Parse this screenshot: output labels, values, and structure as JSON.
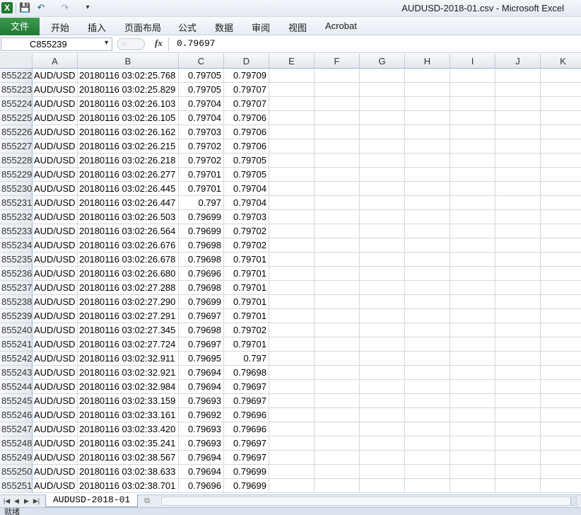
{
  "window": {
    "title": "AUDUSD-2018-01.csv  -  Microsoft Excel",
    "app_icon": "X"
  },
  "quick_access": {
    "save_icon": "💾",
    "undo_icon": "↶",
    "redo_icon": "↷",
    "customize_icon": "▾"
  },
  "ribbon": {
    "file_tab": "文件",
    "tabs": [
      "开始",
      "插入",
      "页面布局",
      "公式",
      "数据",
      "审阅",
      "视图",
      "Acrobat"
    ]
  },
  "formula_bar": {
    "name_box": "C855239",
    "fx": "fx",
    "value": "0.79697"
  },
  "columns": [
    "A",
    "B",
    "C",
    "D",
    "E",
    "F",
    "G",
    "H",
    "I",
    "J",
    "K"
  ],
  "rows": [
    {
      "n": "855222",
      "a": "AUD/USD",
      "b": "20180116 03:02:25.768",
      "c": "0.79705",
      "d": "0.79709"
    },
    {
      "n": "855223",
      "a": "AUD/USD",
      "b": "20180116 03:02:25.829",
      "c": "0.79705",
      "d": "0.79707"
    },
    {
      "n": "855224",
      "a": "AUD/USD",
      "b": "20180116 03:02:26.103",
      "c": "0.79704",
      "d": "0.79707"
    },
    {
      "n": "855225",
      "a": "AUD/USD",
      "b": "20180116 03:02:26.105",
      "c": "0.79704",
      "d": "0.79706"
    },
    {
      "n": "855226",
      "a": "AUD/USD",
      "b": "20180116 03:02:26.162",
      "c": "0.79703",
      "d": "0.79706"
    },
    {
      "n": "855227",
      "a": "AUD/USD",
      "b": "20180116 03:02:26.215",
      "c": "0.79702",
      "d": "0.79706"
    },
    {
      "n": "855228",
      "a": "AUD/USD",
      "b": "20180116 03:02:26.218",
      "c": "0.79702",
      "d": "0.79705"
    },
    {
      "n": "855229",
      "a": "AUD/USD",
      "b": "20180116 03:02:26.277",
      "c": "0.79701",
      "d": "0.79705"
    },
    {
      "n": "855230",
      "a": "AUD/USD",
      "b": "20180116 03:02:26.445",
      "c": "0.79701",
      "d": "0.79704"
    },
    {
      "n": "855231",
      "a": "AUD/USD",
      "b": "20180116 03:02:26.447",
      "c": "0.797",
      "d": "0.79704"
    },
    {
      "n": "855232",
      "a": "AUD/USD",
      "b": "20180116 03:02:26.503",
      "c": "0.79699",
      "d": "0.79703"
    },
    {
      "n": "855233",
      "a": "AUD/USD",
      "b": "20180116 03:02:26.564",
      "c": "0.79699",
      "d": "0.79702"
    },
    {
      "n": "855234",
      "a": "AUD/USD",
      "b": "20180116 03:02:26.676",
      "c": "0.79698",
      "d": "0.79702"
    },
    {
      "n": "855235",
      "a": "AUD/USD",
      "b": "20180116 03:02:26.678",
      "c": "0.79698",
      "d": "0.79701"
    },
    {
      "n": "855236",
      "a": "AUD/USD",
      "b": "20180116 03:02:26.680",
      "c": "0.79696",
      "d": "0.79701"
    },
    {
      "n": "855237",
      "a": "AUD/USD",
      "b": "20180116 03:02:27.288",
      "c": "0.79698",
      "d": "0.79701"
    },
    {
      "n": "855238",
      "a": "AUD/USD",
      "b": "20180116 03:02:27.290",
      "c": "0.79699",
      "d": "0.79701"
    },
    {
      "n": "855239",
      "a": "AUD/USD",
      "b": "20180116 03:02:27.291",
      "c": "0.79697",
      "d": "0.79701"
    },
    {
      "n": "855240",
      "a": "AUD/USD",
      "b": "20180116 03:02:27.345",
      "c": "0.79698",
      "d": "0.79702"
    },
    {
      "n": "855241",
      "a": "AUD/USD",
      "b": "20180116 03:02:27.724",
      "c": "0.79697",
      "d": "0.79701"
    },
    {
      "n": "855242",
      "a": "AUD/USD",
      "b": "20180116 03:02:32.911",
      "c": "0.79695",
      "d": "0.797"
    },
    {
      "n": "855243",
      "a": "AUD/USD",
      "b": "20180116 03:02:32.921",
      "c": "0.79694",
      "d": "0.79698"
    },
    {
      "n": "855244",
      "a": "AUD/USD",
      "b": "20180116 03:02:32.984",
      "c": "0.79694",
      "d": "0.79697"
    },
    {
      "n": "855245",
      "a": "AUD/USD",
      "b": "20180116 03:02:33.159",
      "c": "0.79693",
      "d": "0.79697"
    },
    {
      "n": "855246",
      "a": "AUD/USD",
      "b": "20180116 03:02:33.161",
      "c": "0.79692",
      "d": "0.79696"
    },
    {
      "n": "855247",
      "a": "AUD/USD",
      "b": "20180116 03:02:33.420",
      "c": "0.79693",
      "d": "0.79696"
    },
    {
      "n": "855248",
      "a": "AUD/USD",
      "b": "20180116 03:02:35.241",
      "c": "0.79693",
      "d": "0.79697"
    },
    {
      "n": "855249",
      "a": "AUD/USD",
      "b": "20180116 03:02:38.567",
      "c": "0.79694",
      "d": "0.79697"
    },
    {
      "n": "855250",
      "a": "AUD/USD",
      "b": "20180116 03:02:38.633",
      "c": "0.79694",
      "d": "0.79699"
    },
    {
      "n": "855251",
      "a": "AUD/USD",
      "b": "20180116 03:02:38.701",
      "c": "0.79696",
      "d": "0.79699"
    }
  ],
  "sheet_tabs": {
    "nav_first": "|◀",
    "nav_prev": "◀",
    "nav_next": "▶",
    "nav_last": "▶|",
    "active_sheet": "AUDUSD-2018-01"
  },
  "status_bar": {
    "text": "就绪"
  },
  "colors": {
    "file_tab": "#217a36",
    "grid_line": "#d4d8dd",
    "header_bg": "#e4e8ee"
  }
}
